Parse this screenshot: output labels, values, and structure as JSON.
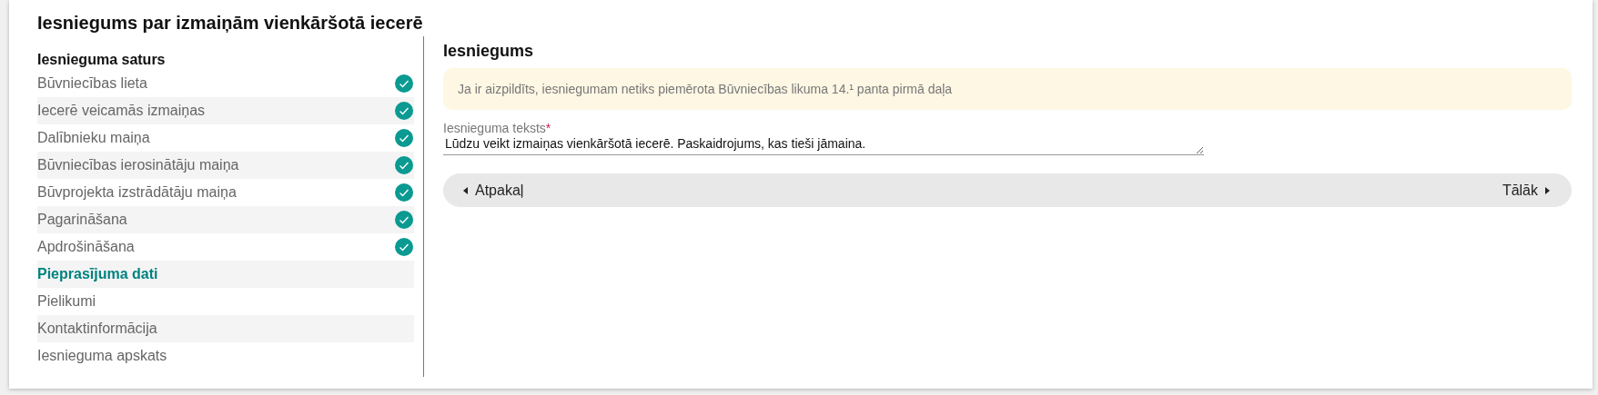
{
  "title": "Iesniegums par izmaiņām vienkāršotā iecerē",
  "sidebar": {
    "heading": "Iesnieguma saturs",
    "items": [
      {
        "label": "Būvniecības lieta",
        "done": true,
        "selected": false
      },
      {
        "label": "Iecerē veicamās izmaiņas",
        "done": true,
        "selected": false
      },
      {
        "label": "Dalībnieku maiņa",
        "done": true,
        "selected": false
      },
      {
        "label": "Būvniecības ierosinātāju maiņa",
        "done": true,
        "selected": false
      },
      {
        "label": "Būvprojekta izstrādātāju maiņa",
        "done": true,
        "selected": false
      },
      {
        "label": "Pagarināšana",
        "done": true,
        "selected": false
      },
      {
        "label": "Apdrošināšana",
        "done": true,
        "selected": false
      },
      {
        "label": "Pieprasījuma dati",
        "done": false,
        "selected": true
      },
      {
        "label": "Pielikumi",
        "done": false,
        "selected": false
      },
      {
        "label": "Kontaktinformācija",
        "done": false,
        "selected": false
      },
      {
        "label": "Iesnieguma apskats",
        "done": false,
        "selected": false
      }
    ]
  },
  "section": {
    "title": "Iesniegums",
    "notice": "Ja ir aizpildīts, iesniegumam netiks piemērota Būvniecības likuma 14.¹ panta pirmā daļa",
    "field": {
      "label": "Iesnieguma teksts",
      "required": "*",
      "value": "Lūdzu veikt izmaiņas vienkāršotā iecerē. Paskaidrojums, kas tieši jāmaina."
    },
    "nav": {
      "back": "Atpakaļ",
      "next": "Tālāk"
    }
  }
}
